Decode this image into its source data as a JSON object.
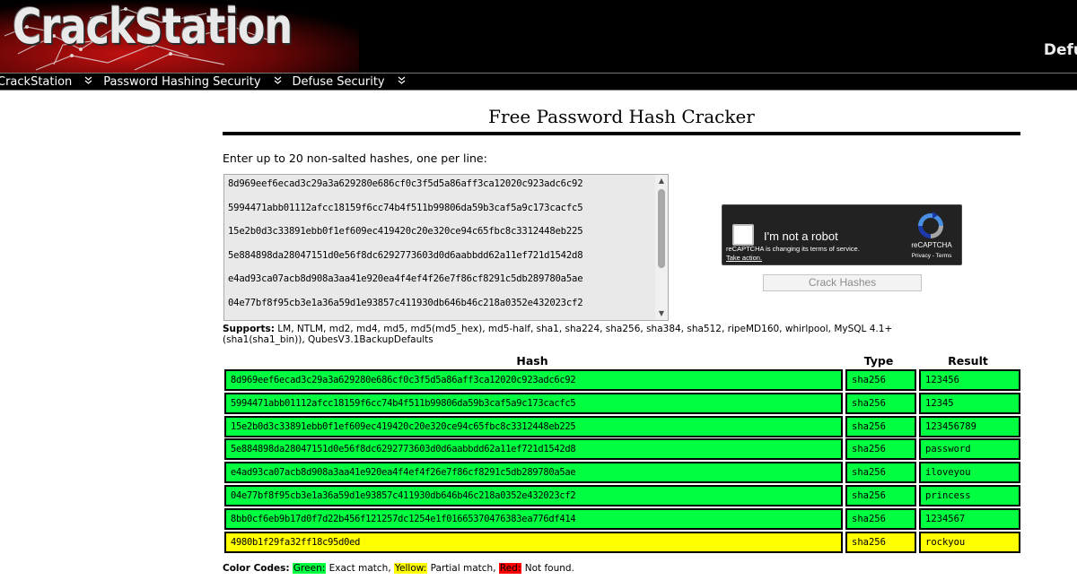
{
  "header": {
    "logo": "CrackStation",
    "right_text": "Defu"
  },
  "nav": {
    "items": [
      {
        "label": "CrackStation"
      },
      {
        "label": "Password Hashing Security"
      },
      {
        "label": "Defuse Security"
      }
    ],
    "chevron": "»"
  },
  "page": {
    "title": "Free Password Hash Cracker",
    "instructions": "Enter up to 20 non-salted hashes, one per line:"
  },
  "input_box": {
    "lines": [
      "8d969eef6ecad3c29a3a629280e686cf0c3f5d5a86aff3ca12020c923adc6c92",
      "5994471abb01112afcc18159f6cc74b4f511b99806da59b3caf5a9c173cacfc5",
      "15e2b0d3c33891ebb0f1ef609ec419420c20e320ce94c65fbc8c3312448eb225",
      "5e884898da28047151d0e56f8dc6292773603d0d6aabbdd62a11ef721d1542d8",
      "e4ad93ca07acb8d908a3aa41e920ea4f4ef4f26e7f86cf8291c5db289780a5ae",
      "04e77bf8f95cb3e1a36a59d1e93857c411930db646b46c218a0352e432023cf2"
    ]
  },
  "captcha": {
    "label": "I'm not a robot",
    "notice": "reCAPTCHA is changing its terms of service.",
    "notice_link": "Take action.",
    "brand": "reCAPTCHA",
    "links": "Privacy - Terms"
  },
  "crack_button": "Crack Hashes",
  "supports": {
    "label": "Supports:",
    "text": "LM, NTLM, md2, md4, md5, md5(md5_hex), md5-half, sha1, sha224, sha256, sha384, sha512, ripeMD160, whirlpool, MySQL 4.1+ (sha1(sha1_bin)), QubesV3.1BackupDefaults"
  },
  "results": {
    "headers": {
      "hash": "Hash",
      "type": "Type",
      "result": "Result"
    },
    "rows": [
      {
        "hash": "8d969eef6ecad3c29a3a629280e686cf0c3f5d5a86aff3ca12020c923adc6c92",
        "type": "sha256",
        "result": "123456",
        "status": "exact"
      },
      {
        "hash": "5994471abb01112afcc18159f6cc74b4f511b99806da59b3caf5a9c173cacfc5",
        "type": "sha256",
        "result": "12345",
        "status": "exact"
      },
      {
        "hash": "15e2b0d3c33891ebb0f1ef609ec419420c20e320ce94c65fbc8c3312448eb225",
        "type": "sha256",
        "result": "123456789",
        "status": "exact"
      },
      {
        "hash": "5e884898da28047151d0e56f8dc6292773603d0d6aabbdd62a11ef721d1542d8",
        "type": "sha256",
        "result": "password",
        "status": "exact"
      },
      {
        "hash": "e4ad93ca07acb8d908a3aa41e920ea4f4ef4f26e7f86cf8291c5db289780a5ae",
        "type": "sha256",
        "result": "iloveyou",
        "status": "exact"
      },
      {
        "hash": "04e77bf8f95cb3e1a36a59d1e93857c411930db646b46c218a0352e432023cf2",
        "type": "sha256",
        "result": "princess",
        "status": "exact"
      },
      {
        "hash": "8bb0cf6eb9b17d0f7d22b456f121257dc1254e1f01665370476383ea776df414",
        "type": "sha256",
        "result": "1234567",
        "status": "exact"
      },
      {
        "hash": "4980b1f29fa32ff18c95d0ed",
        "type": "sha256",
        "result": "rockyou",
        "status": "partial"
      }
    ]
  },
  "legend": {
    "label": "Color Codes:",
    "green": "Green:",
    "green_text": "Exact match,",
    "yellow": "Yellow:",
    "yellow_text": "Partial match,",
    "red": "Red:",
    "red_text": "Not found."
  },
  "colors": {
    "exact": "#00ff40",
    "partial": "#ffff00",
    "not_found": "#ff0000",
    "header_bg": "#000000"
  }
}
